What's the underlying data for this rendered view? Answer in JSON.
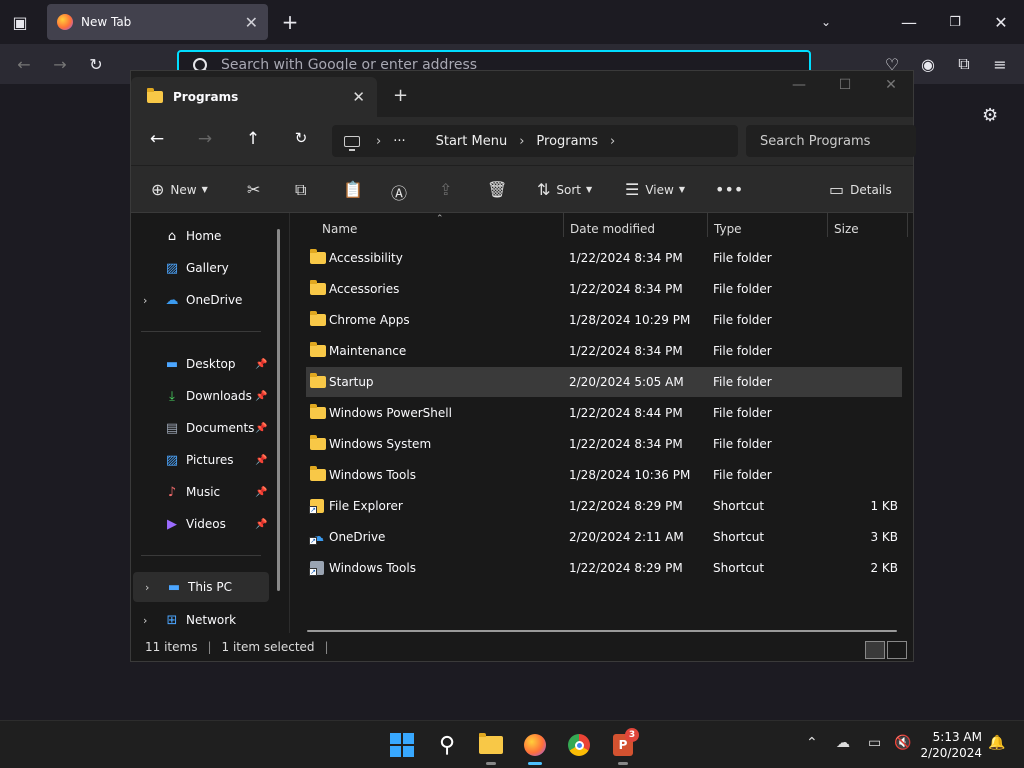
{
  "browser": {
    "tab_title": "New Tab",
    "url_placeholder": "Search with Google or enter address"
  },
  "explorer": {
    "tab_title": "Programs",
    "breadcrumb": [
      "Start Menu",
      "Programs"
    ],
    "search_placeholder": "Search Programs",
    "commands": {
      "new_label": "New",
      "sort_label": "Sort",
      "view_label": "View",
      "details_label": "Details"
    },
    "sidebar": {
      "quick": [
        {
          "label": "Home",
          "icon": "home-icon"
        },
        {
          "label": "Gallery",
          "icon": "gallery-icon"
        },
        {
          "label": "OneDrive",
          "icon": "cloud-icon"
        }
      ],
      "pinned": [
        {
          "label": "Desktop",
          "icon": "desktop-icon"
        },
        {
          "label": "Downloads",
          "icon": "download-icon"
        },
        {
          "label": "Documents",
          "icon": "document-icon"
        },
        {
          "label": "Pictures",
          "icon": "pictures-icon"
        },
        {
          "label": "Music",
          "icon": "music-icon"
        },
        {
          "label": "Videos",
          "icon": "video-icon"
        }
      ],
      "devices": [
        {
          "label": "This PC",
          "icon": "pc-icon"
        },
        {
          "label": "Network",
          "icon": "network-icon"
        }
      ]
    },
    "columns": {
      "name": "Name",
      "date": "Date modified",
      "type": "Type",
      "size": "Size"
    },
    "files": [
      {
        "name": "Accessibility",
        "date": "1/22/2024 8:34 PM",
        "type": "File folder",
        "size": ""
      },
      {
        "name": "Accessories",
        "date": "1/22/2024 8:34 PM",
        "type": "File folder",
        "size": ""
      },
      {
        "name": "Chrome Apps",
        "date": "1/28/2024 10:29 PM",
        "type": "File folder",
        "size": ""
      },
      {
        "name": "Maintenance",
        "date": "1/22/2024 8:34 PM",
        "type": "File folder",
        "size": ""
      },
      {
        "name": "Startup",
        "date": "2/20/2024 5:05 AM",
        "type": "File folder",
        "size": ""
      },
      {
        "name": "Windows PowerShell",
        "date": "1/22/2024 8:44 PM",
        "type": "File folder",
        "size": ""
      },
      {
        "name": "Windows System",
        "date": "1/22/2024 8:34 PM",
        "type": "File folder",
        "size": ""
      },
      {
        "name": "Windows Tools",
        "date": "1/28/2024 10:36 PM",
        "type": "File folder",
        "size": ""
      },
      {
        "name": "File Explorer",
        "date": "1/22/2024 8:29 PM",
        "type": "Shortcut",
        "size": "1 KB"
      },
      {
        "name": "OneDrive",
        "date": "2/20/2024 2:11 AM",
        "type": "Shortcut",
        "size": "3 KB"
      },
      {
        "name": "Windows Tools",
        "date": "1/22/2024 8:29 PM",
        "type": "Shortcut",
        "size": "2 KB"
      }
    ],
    "status": {
      "items": "11 items",
      "selected": "1 item selected"
    }
  },
  "taskbar": {
    "clock_time": "5:13 AM",
    "clock_date": "2/20/2024",
    "powerpoint_badge": "3"
  },
  "colors": {
    "accent": "#00ddff",
    "folder": "#f8c847",
    "windows_blue": "#38a8ff"
  }
}
